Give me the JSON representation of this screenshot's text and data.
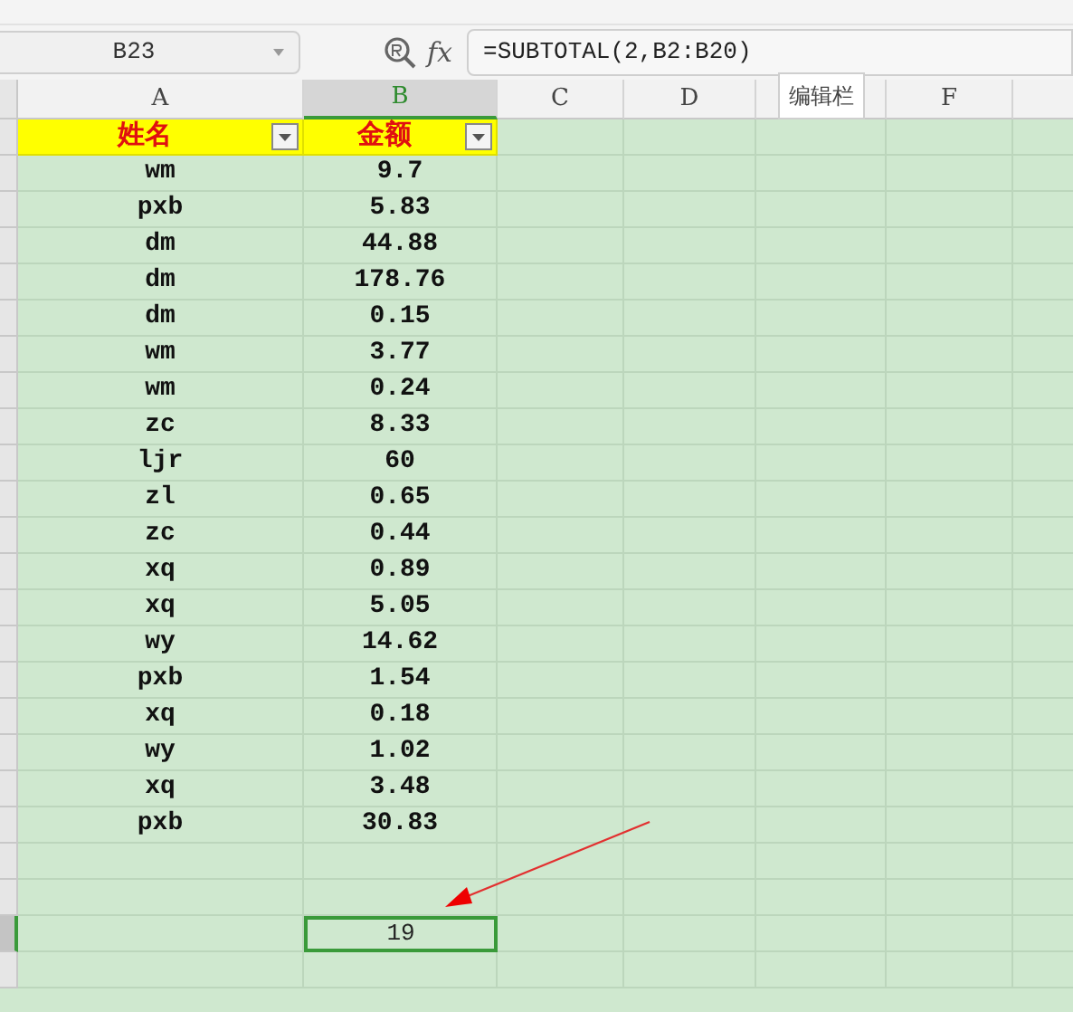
{
  "name_box": {
    "value": "B23"
  },
  "formula_bar": {
    "fx": "fx",
    "value": "=SUBTOTAL(2,B2:B20)"
  },
  "tooltip": "编辑栏",
  "columns": [
    {
      "label": "A",
      "selected": false
    },
    {
      "label": "B",
      "selected": true
    },
    {
      "label": "C",
      "selected": false
    },
    {
      "label": "D",
      "selected": false
    },
    {
      "label": "F",
      "selected": false
    }
  ],
  "table": {
    "header": [
      {
        "text": "姓名",
        "filter": true
      },
      {
        "text": "金额",
        "filter": true
      }
    ],
    "rows": [
      [
        "wm",
        "9.7"
      ],
      [
        "pxb",
        "5.83"
      ],
      [
        "dm",
        "44.88"
      ],
      [
        "dm",
        "178.76"
      ],
      [
        "dm",
        "0.15"
      ],
      [
        "wm",
        "3.77"
      ],
      [
        "wm",
        "0.24"
      ],
      [
        "zc",
        "8.33"
      ],
      [
        "ljr",
        "60"
      ],
      [
        "zl",
        "0.65"
      ],
      [
        "zc",
        "0.44"
      ],
      [
        "xq",
        "0.89"
      ],
      [
        "xq",
        "5.05"
      ],
      [
        "wy",
        "14.62"
      ],
      [
        "pxb",
        "1.54"
      ],
      [
        "xq",
        "0.18"
      ],
      [
        "wy",
        "1.02"
      ],
      [
        "xq",
        "3.48"
      ],
      [
        "pxb",
        "30.83"
      ]
    ],
    "result": {
      "value": "19",
      "selected": true
    }
  }
}
